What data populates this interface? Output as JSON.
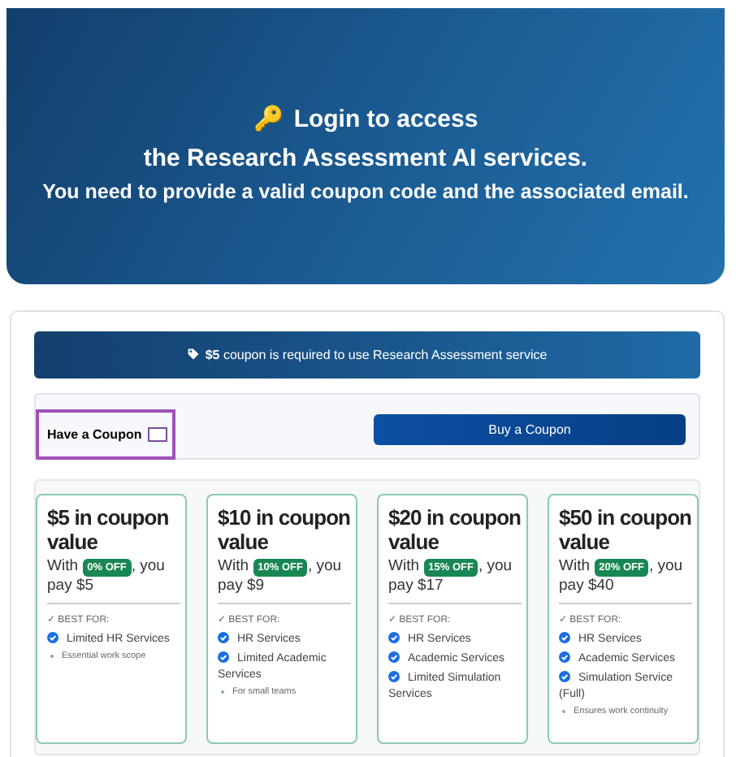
{
  "hero": {
    "icon": "🔑",
    "title": "Login to access",
    "subtitle": "the Research Assessment AI services.",
    "note": "You need to provide a valid coupon code and the associated email."
  },
  "banner": {
    "amount": "$5",
    "text": " coupon is required to use Research Assessment service"
  },
  "coupon_row": {
    "label": "Have a Coupon",
    "checked": false,
    "highlighted": true,
    "button": "Buy a Coupon"
  },
  "plans": [
    {
      "title": "$5 in coupon value",
      "prefix": "With ",
      "discount": "0% OFF",
      "suffix": ", you pay $5",
      "best_for": "✓ BEST FOR:",
      "features": [
        {
          "kind": "check",
          "text": "Limited HR Services"
        },
        {
          "kind": "note",
          "text": "Essential work scope"
        }
      ]
    },
    {
      "title": "$10 in coupon value",
      "prefix": "With ",
      "discount": "10% OFF",
      "suffix": ", you pay $9",
      "best_for": "✓ BEST FOR:",
      "features": [
        {
          "kind": "check",
          "text": "HR Services"
        },
        {
          "kind": "check",
          "text": "Limited Academic Services"
        },
        {
          "kind": "note",
          "text": "For small teams"
        }
      ]
    },
    {
      "title": "$20 in coupon value",
      "prefix": "With ",
      "discount": "15% OFF",
      "suffix": ", you pay $17",
      "best_for": "✓ BEST FOR:",
      "features": [
        {
          "kind": "check",
          "text": "HR Services"
        },
        {
          "kind": "check",
          "text": "Academic Services"
        },
        {
          "kind": "check",
          "text": "Limited Simulation Services"
        }
      ]
    },
    {
      "title": "$50 in coupon value",
      "prefix": "With ",
      "discount": "20% OFF",
      "suffix": ", you pay $40",
      "best_for": "✓ BEST FOR:",
      "features": [
        {
          "kind": "check",
          "text": "HR Services"
        },
        {
          "kind": "check",
          "text": "Academic Services"
        },
        {
          "kind": "check",
          "text": "Simulation Service (Full)"
        },
        {
          "kind": "note",
          "text": "Ensures work continuity"
        }
      ]
    }
  ]
}
